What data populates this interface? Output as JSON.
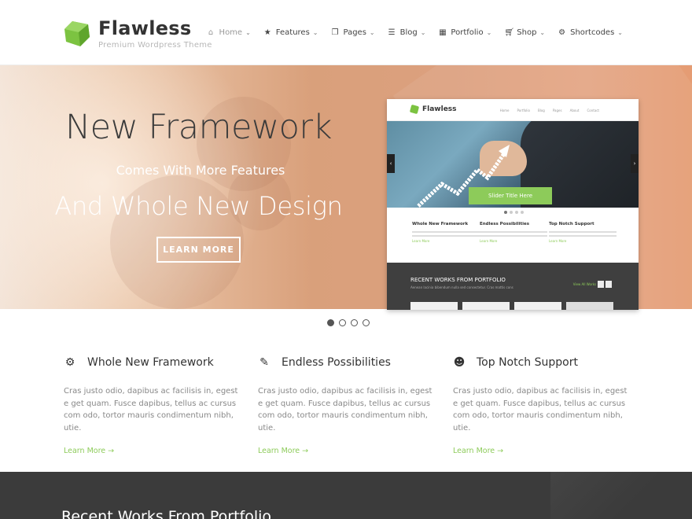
{
  "logo": {
    "title": "Flawless",
    "tagline": "Premium Wordpress Theme",
    "accent": "#7cc341"
  },
  "nav": [
    {
      "label": "Home",
      "icon": "home-icon",
      "active": true
    },
    {
      "label": "Features",
      "icon": "star-icon"
    },
    {
      "label": "Pages",
      "icon": "pages-icon"
    },
    {
      "label": "Blog",
      "icon": "list-icon"
    },
    {
      "label": "Portfolio",
      "icon": "grid-icon"
    },
    {
      "label": "Shop",
      "icon": "cart-icon"
    },
    {
      "label": "Shortcodes",
      "icon": "gear-icon"
    }
  ],
  "hero": {
    "title": "New Framework",
    "subtitle": "Comes With More Features",
    "title2": "And Whole New Design",
    "button": "LEARN MORE"
  },
  "mock": {
    "logo": "Flawless",
    "nav": [
      "Home",
      "Portfolio",
      "Blog",
      "Pages",
      "About",
      "Contact"
    ],
    "caption": "Slider Title Here",
    "features": [
      "Whole New Framework",
      "Endless Possibilities",
      "Top Notch Support"
    ],
    "more": "Learn More",
    "dark_title": "RECENT WORKS FROM PORTFOLIO",
    "dark_sub": "Aenean lacinia bibendum nulla sed consectetur. Cras mattis cons",
    "view_all": "View All Works"
  },
  "slider_dots": 4,
  "features": [
    {
      "icon": "cogs-icon",
      "title": "Whole New Framework",
      "text": "Cras justo odio, dapibus ac facilisis in, egest e get quam. Fusce dapibus, tellus ac cursus com odo, tortor mauris condimentum nibh, utie.",
      "link": "Learn More →"
    },
    {
      "icon": "magic-wand-icon",
      "title": "Endless Possibilities",
      "text": "Cras justo odio, dapibus ac facilisis in, egest e get quam. Fusce dapibus, tellus ac cursus com odo, tortor mauris condimentum nibh, utie.",
      "link": "Learn More →"
    },
    {
      "icon": "users-icon",
      "title": "Top Notch Support",
      "text": "Cras justo odio, dapibus ac facilisis in, egest e get quam. Fusce dapibus, tellus ac cursus com odo, tortor mauris condimentum nibh, utie.",
      "link": "Learn More →"
    }
  ],
  "portfolio": {
    "title": "Recent Works From Portfolio"
  }
}
